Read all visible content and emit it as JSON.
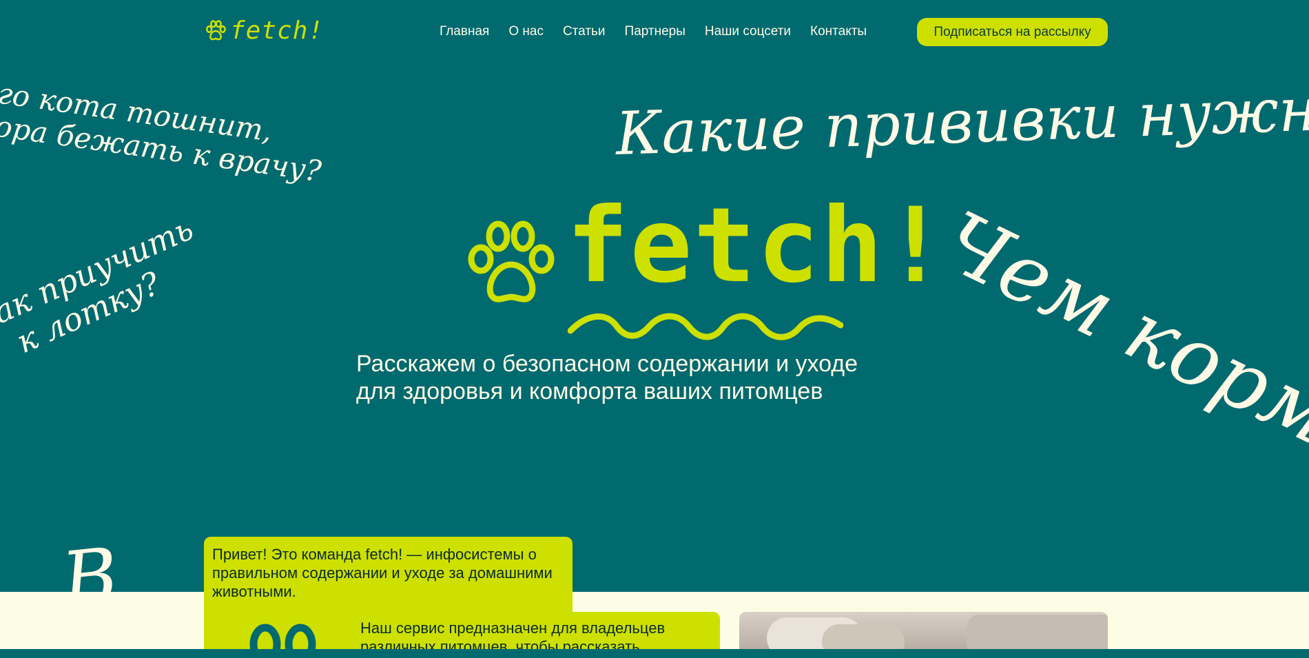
{
  "brand": {
    "name": "fetch!",
    "accent_color": "#cde000",
    "background_color": "#016a6f",
    "cream_color": "#fdfde6",
    "logo_icon": "paw-icon"
  },
  "nav": {
    "items": [
      {
        "label": "Главная"
      },
      {
        "label": "О нас"
      },
      {
        "label": "Статьи"
      },
      {
        "label": "Партнеры"
      },
      {
        "label": "Наши соцсети"
      },
      {
        "label": "Контакты"
      }
    ],
    "subscribe_label": "Подписаться на рассылку"
  },
  "hero": {
    "logo_text": "fetch!",
    "subtitle_line1": "Расскажем о безопасном содержании и уходе",
    "subtitle_line2": "для здоровья и комфорта ваших питомцев"
  },
  "questions": {
    "vomit_line1": "его кота тошнит,",
    "vomit_line2": "пора бежать к врачу?",
    "vaccines": "Какие прививки нужны?",
    "litter_line1": "ак приучить",
    "litter_line2": "к лотку?",
    "feed": "Чем корм",
    "bottom": "В"
  },
  "intro": {
    "text": "Привет! Это команда fetch! — инфосистемы о правильном содержании и уходе за домашними животными."
  },
  "service": {
    "text": "Наш сервис предназначен для владельцев различных питомцев, чтобы рассказать"
  }
}
